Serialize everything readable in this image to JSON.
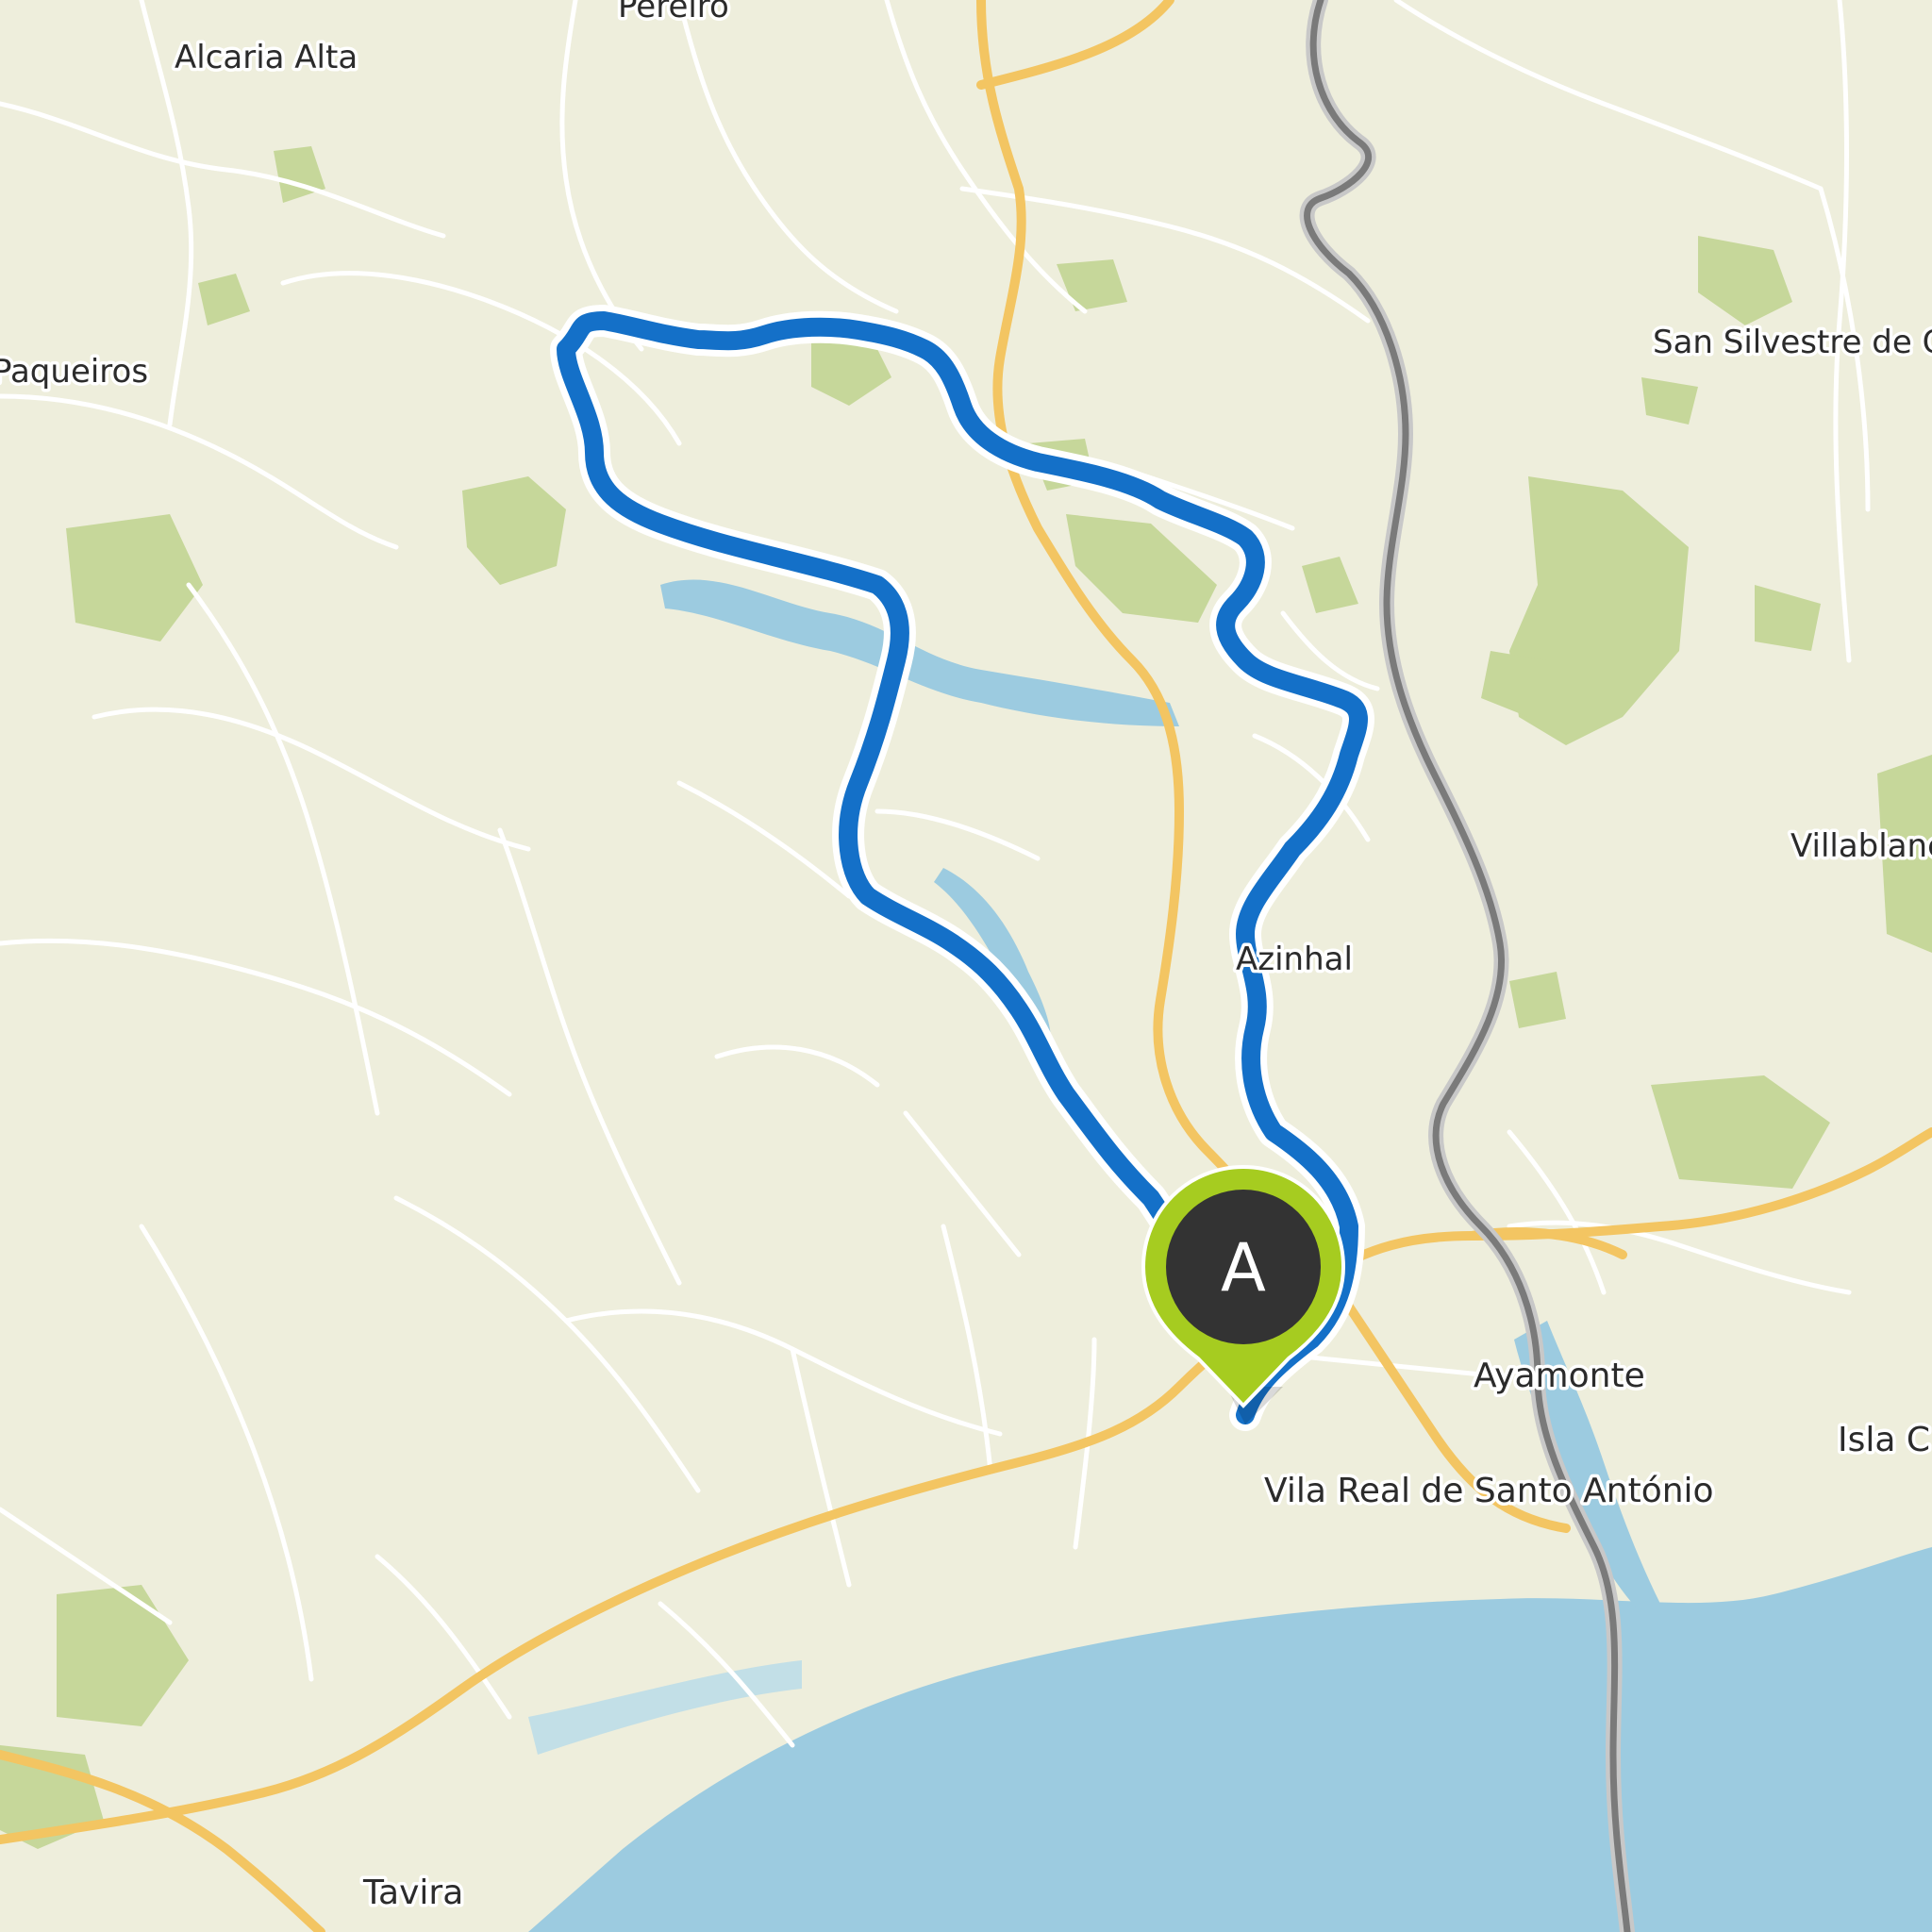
{
  "map": {
    "colors": {
      "land": "#eeeedc",
      "sea": "#9ccbe0",
      "forest": "#c6d79a",
      "road_major": "#f3c562",
      "road_minor": "#ffffff",
      "border": "#7a7a7a",
      "route": "#1470c8",
      "marker_ring": "#a6cc20",
      "marker_fill": "#333333"
    },
    "labels": {
      "alcaria_alta": "Alcaria Alta",
      "pereiro": "Pereiro",
      "paqueiros": "Paqueiros",
      "san_silvestre": "San Silvestre de Gu",
      "villablanca": "Villablanc",
      "azinhal": "Azinhal",
      "ayamonte": "Ayamonte",
      "isla": "Isla C",
      "vila_real": "Vila Real de Santo António",
      "tavira": "Tavira"
    },
    "marker": {
      "letter": "A",
      "icon": "map-pin-icon"
    }
  }
}
